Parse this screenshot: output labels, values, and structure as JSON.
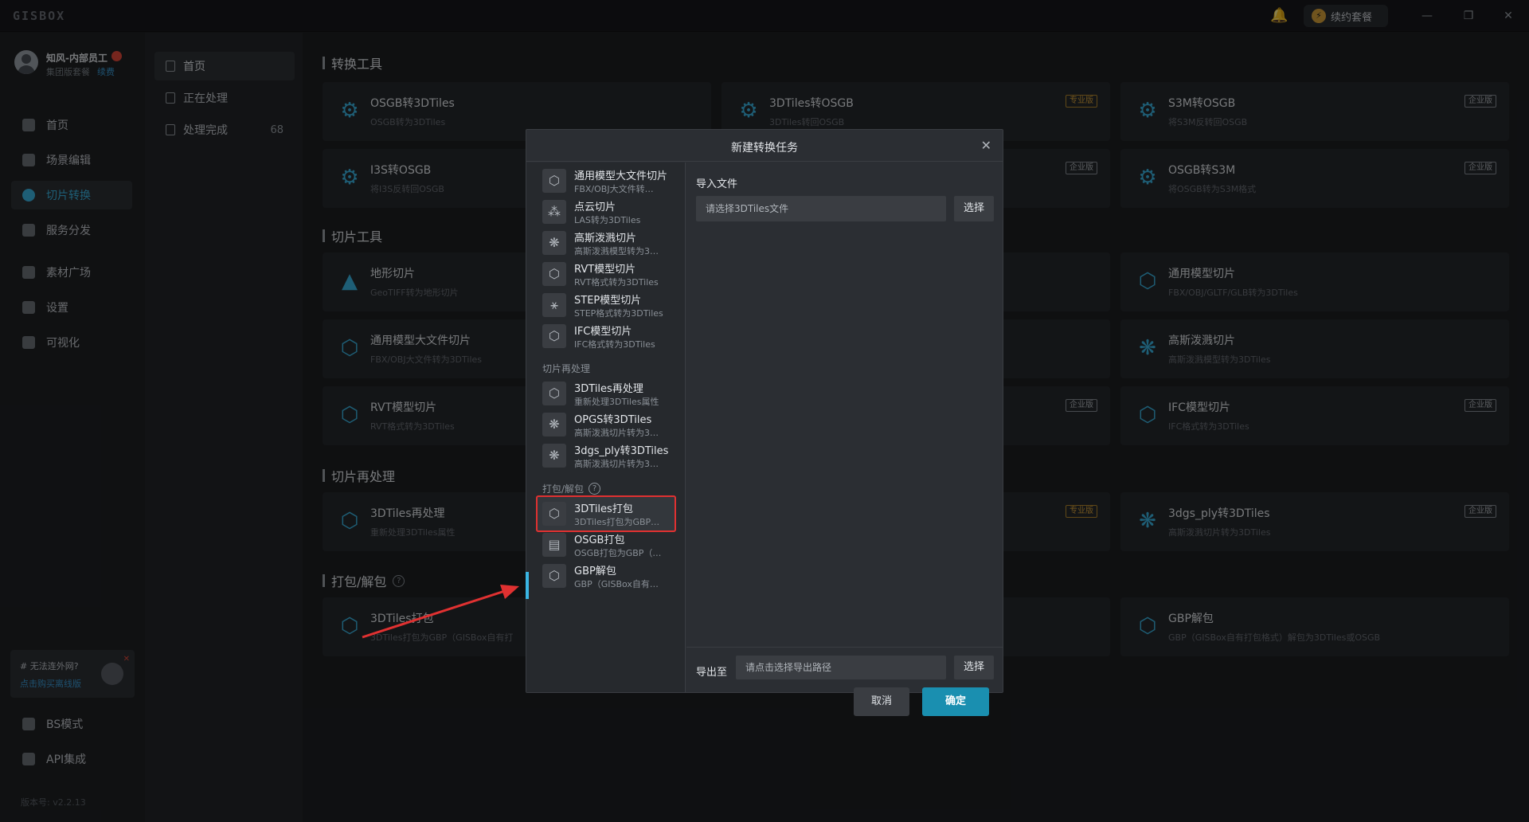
{
  "app": {
    "logo": "GISBOX",
    "renew": "续约套餐",
    "window_controls": [
      "—",
      "❐",
      "✕"
    ]
  },
  "user": {
    "name": "知风-内部员工",
    "plan": "集团版套餐",
    "renew": "续费"
  },
  "sidebar": {
    "items": [
      {
        "label": "首页",
        "icon": "home-icon"
      },
      {
        "label": "场景编辑",
        "icon": "cube-icon"
      },
      {
        "label": "切片转换",
        "icon": "swap-icon"
      },
      {
        "label": "服务分发",
        "icon": "upload-icon"
      },
      {
        "label": "素材广场",
        "icon": "chart-icon"
      },
      {
        "label": "设置",
        "icon": "gear-icon"
      },
      {
        "label": "可视化",
        "icon": "c-icon"
      },
      {
        "label": "BS模式",
        "icon": "code-icon"
      },
      {
        "label": "API集成",
        "icon": "plug-icon"
      }
    ],
    "active": "切片转换",
    "promo": {
      "title": "# 无法连外网?",
      "link": "点击购买离线版"
    },
    "version": "版本号: v2.2.13"
  },
  "subnav": {
    "items": [
      {
        "label": "首页",
        "count": ""
      },
      {
        "label": "正在处理",
        "count": ""
      },
      {
        "label": "处理完成",
        "count": "68"
      }
    ]
  },
  "main": {
    "sections": [
      {
        "title": "转换工具"
      },
      {
        "title": "切片工具"
      },
      {
        "title": "切片再处理"
      },
      {
        "title": "打包/解包"
      }
    ],
    "badges": {
      "pro": "专业版",
      "ent": "企业版"
    },
    "cards": [
      {
        "title": "OSGB转3DTiles",
        "sub": "OSGB转为3DTiles"
      },
      {
        "title": "3DTiles转OSGB",
        "sub": "3DTiles转回OSGB",
        "badge": "专业版"
      },
      {
        "title": "S3M转OSGB",
        "sub": "将S3M反转回OSGB",
        "badge": "企业版"
      },
      {
        "title": "I3S转OSGB",
        "sub": "将I3S反转回OSGB"
      },
      {
        "title": "",
        "sub": "",
        "badge": "企业版"
      },
      {
        "title": "OSGB转S3M",
        "sub": "将OSGB转为S3M格式",
        "badge": "企业版"
      },
      {
        "title": "地形切片",
        "sub": "GeoTIFF转为地形切片"
      },
      {
        "title": "",
        "sub": ""
      },
      {
        "title": "通用模型切片",
        "sub": "FBX/OBJ/GLTF/GLB转为3DTiles"
      },
      {
        "title": "通用模型大文件切片",
        "sub": "FBX/OBJ大文件转为3DTiles"
      },
      {
        "title": "",
        "sub": ""
      },
      {
        "title": "高斯泼溅切片",
        "sub": "高斯泼溅模型转为3DTiles"
      },
      {
        "title": "RVT模型切片",
        "sub": "RVT格式转为3DTiles"
      },
      {
        "title": "",
        "sub": "",
        "badge": "企业版"
      },
      {
        "title": "IFC模型切片",
        "sub": "IFC格式转为3DTiles",
        "badge": "企业版"
      },
      {
        "title": "3DTiles再处理",
        "sub": "重新处理3DTiles属性"
      },
      {
        "title": "",
        "sub": "",
        "badge": "专业版"
      },
      {
        "title": "3dgs_ply转3DTiles",
        "sub": "高斯泼溅切片转为3DTiles",
        "badge": "企业版"
      },
      {
        "title": "3DTiles打包",
        "sub": "3DTiles打包为GBP（GISBox自有打"
      },
      {
        "title": "",
        "sub": ""
      },
      {
        "title": "GBP解包",
        "sub": "GBP（GISBox自有打包格式）解包为3DTiles或OSGB"
      }
    ]
  },
  "modal": {
    "title": "新建转换任务",
    "list": [
      {
        "title": "通用模型大文件切片",
        "sub": "FBX/OBJ大文件转…"
      },
      {
        "title": "点云切片",
        "sub": "LAS转为3DTiles"
      },
      {
        "title": "高斯泼溅切片",
        "sub": "高斯泼溅模型转为3…"
      },
      {
        "title": "RVT模型切片",
        "sub": "RVT格式转为3DTiles"
      },
      {
        "title": "STEP模型切片",
        "sub": "STEP格式转为3DTiles"
      },
      {
        "title": "IFC模型切片",
        "sub": "IFC格式转为3DTiles"
      },
      {
        "title": "3DTiles再处理",
        "sub": "重新处理3DTiles属性"
      },
      {
        "title": "OPGS转3DTiles",
        "sub": "高斯泼溅切片转为3…"
      },
      {
        "title": "3dgs_ply转3DTiles",
        "sub": "高斯泼溅切片转为3…"
      },
      {
        "title": "3DTiles打包",
        "sub": "3DTiles打包为GBP…"
      },
      {
        "title": "OSGB打包",
        "sub": "OSGB打包为GBP（…"
      },
      {
        "title": "GBP解包",
        "sub": "GBP（GISBox自有…"
      }
    ],
    "groups": {
      "reprocess": "切片再处理",
      "pack": "打包/解包"
    },
    "selected": "3DTiles打包",
    "import_label": "导入文件",
    "import_placeholder": "请选择3DTiles文件",
    "choose": "选择",
    "export_label": "导出至",
    "export_placeholder": "请点击选择导出路径",
    "cancel": "取消",
    "confirm": "确定"
  },
  "colors": {
    "accent": "#3ab5e3",
    "confirm": "#1a8fb0",
    "highlight": "#e03131",
    "pro": "#d7a13a"
  }
}
